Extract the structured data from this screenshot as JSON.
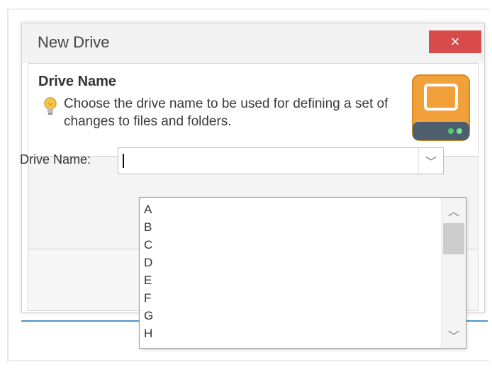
{
  "dialog": {
    "title": "New Drive",
    "close_label": "×"
  },
  "header": {
    "section_title": "Drive Name",
    "description": "Choose the drive name to be used for defining a set of changes to files and folders."
  },
  "form": {
    "drive_name_label": "Drive Name:",
    "drive_name_value": "",
    "combo_arrow": "﹀"
  },
  "dropdown": {
    "options": [
      "A",
      "B",
      "C",
      "D",
      "E",
      "F",
      "G",
      "H"
    ],
    "scroll_up": "︿",
    "scroll_down": "﹀"
  },
  "colors": {
    "close_button": "#d94a4a",
    "accent_line": "#4a93c9",
    "drive_icon_orange": "#f2a03a"
  }
}
